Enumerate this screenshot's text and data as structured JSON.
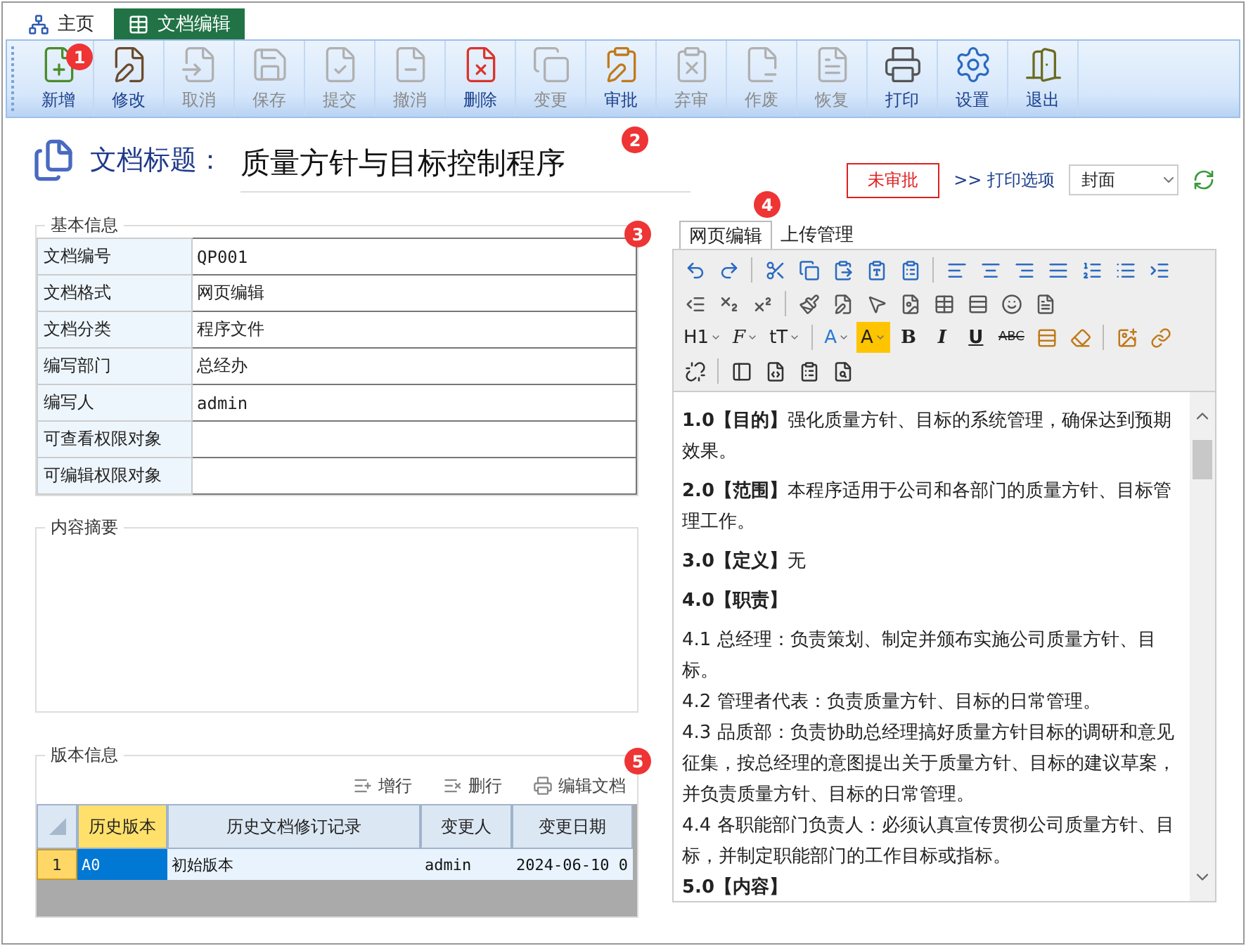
{
  "tabs": [
    {
      "label": "主页",
      "selected": false
    },
    {
      "label": "文档编辑",
      "selected": true
    }
  ],
  "toolbar": [
    {
      "label": "新增",
      "disabled": false,
      "badge": "1"
    },
    {
      "label": "修改",
      "disabled": false
    },
    {
      "label": "取消",
      "disabled": true
    },
    {
      "label": "保存",
      "disabled": true
    },
    {
      "label": "提交",
      "disabled": true
    },
    {
      "label": "撤消",
      "disabled": true
    },
    {
      "label": "删除",
      "disabled": false
    },
    {
      "label": "变更",
      "disabled": true
    },
    {
      "label": "审批",
      "disabled": false
    },
    {
      "label": "弃审",
      "disabled": true
    },
    {
      "label": "作废",
      "disabled": true
    },
    {
      "label": "恢复",
      "disabled": true
    },
    {
      "label": "打印",
      "disabled": false
    },
    {
      "label": "设置",
      "disabled": false
    },
    {
      "label": "退出",
      "disabled": false
    }
  ],
  "title": {
    "label": "文档标题：",
    "value": "质量方针与目标控制程序",
    "badge": "2"
  },
  "status": "未审批",
  "print_options": {
    "label": ">> 打印选项",
    "value": "封面"
  },
  "basic_info": {
    "legend": "基本信息",
    "badge": "3",
    "fields": [
      {
        "label": "文档编号",
        "value": "QP001"
      },
      {
        "label": "文档格式",
        "value": "网页编辑"
      },
      {
        "label": "文档分类",
        "value": "程序文件"
      },
      {
        "label": "编写部门",
        "value": "总经办"
      },
      {
        "label": "编写人",
        "value": "admin"
      },
      {
        "label": "可查看权限对象"
      },
      {
        "label": "可编辑权限对象"
      }
    ]
  },
  "summary": {
    "legend": "内容摘要"
  },
  "versions": {
    "legend": "版本信息",
    "badge": "5",
    "actions": [
      "增行",
      "删行",
      "编辑文档"
    ],
    "columns": [
      {
        "label": "历史版本",
        "selected": true
      },
      {
        "label": "历史文档修订记录",
        "selected": false
      },
      {
        "label": "变更人",
        "selected": false
      },
      {
        "label": "变更日期",
        "selected": false
      }
    ],
    "rows": [
      {
        "number": "1",
        "cells": [
          {
            "text": "A0",
            "selected": true
          },
          {
            "text": "初始版本",
            "selected": false
          },
          {
            "text": "admin",
            "selected": false
          },
          {
            "text": "2024-06-10 0",
            "selected": false
          }
        ]
      }
    ]
  },
  "editor": {
    "tabs": [
      {
        "label": "网页编辑",
        "selected": true,
        "badge": "4"
      },
      {
        "label": "上传管理",
        "selected": false
      }
    ],
    "format_buttons": [
      {
        "label": "H1",
        "kind": "dropdown"
      },
      {
        "label": "F",
        "kind": "script"
      },
      {
        "label": "tT",
        "kind": "dropdown"
      },
      {
        "label": "A",
        "kind": "color"
      },
      {
        "label": "A",
        "kind": "highlight"
      },
      {
        "label": "B",
        "kind": "bold"
      },
      {
        "label": "I",
        "kind": "italic"
      },
      {
        "label": "U",
        "kind": "underline"
      },
      {
        "label": "ABC",
        "kind": "strike"
      }
    ],
    "content": [
      {
        "kind": "section",
        "text": "**1.0【目的】**强化质量方针、目标的系统管理，确保达到预期效果。"
      },
      {
        "kind": "section",
        "text": "**2.0【范围】**本程序适用于公司和各部门的质量方针、目标管理工作。"
      },
      {
        "kind": "section",
        "text": "**3.0【定义】**无"
      },
      {
        "kind": "heading",
        "text": "4.0【职责】"
      },
      {
        "kind": "item",
        "text": "4.1 总经理：负责策划、制定并颁布实施公司质量方针、目标。"
      },
      {
        "kind": "item",
        "text": "4.2 管理者代表：负责质量方针、目标的日常管理。"
      },
      {
        "kind": "item",
        "text": "4.3 品质部：负责协助总经理搞好质量方针目标的调研和意见征集，按总经理的意图提出关于质量方针、目标的建议草案，并负责质量方针、目标的日常管理。"
      },
      {
        "kind": "item",
        "text": "4.4 各职能部门负责人：必须认真宣传贯彻公司质量方针、目标，并制定职能部门的工作目标或指标。"
      },
      {
        "kind": "heading",
        "text": "5.0【内容】"
      }
    ]
  }
}
